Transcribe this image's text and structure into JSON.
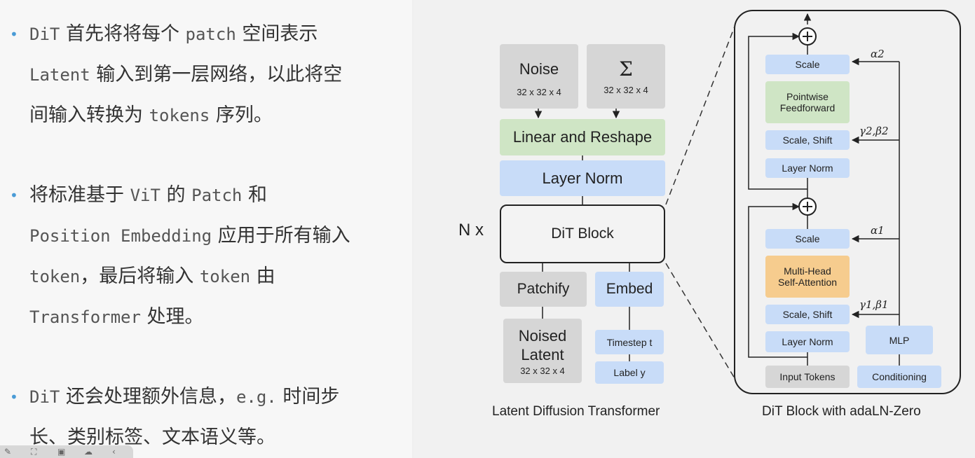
{
  "bullets": [
    {
      "lines": [
        [
          {
            "t": "DiT",
            "m": true
          },
          {
            "t": " 首先将将每个 ",
            "m": false
          },
          {
            "t": "patch",
            "m": true
          },
          {
            "t": " 空间表示",
            "m": false
          }
        ],
        [
          {
            "t": "Latent",
            "m": true
          },
          {
            "t": " 输入到第一层网络，以此将空",
            "m": false
          }
        ],
        [
          {
            "t": "间输入转换为 ",
            "m": false
          },
          {
            "t": "tokens",
            "m": true
          },
          {
            "t": " 序列。",
            "m": false
          }
        ]
      ]
    },
    {
      "lines": [
        [
          {
            "t": "将标准基于 ",
            "m": false
          },
          {
            "t": "ViT",
            "m": true
          },
          {
            "t": " 的 ",
            "m": false
          },
          {
            "t": "Patch",
            "m": true
          },
          {
            "t": " 和",
            "m": false
          }
        ],
        [
          {
            "t": "Position Embedding",
            "m": true
          },
          {
            "t": " 应用于所有输入",
            "m": false
          }
        ],
        [
          {
            "t": "token",
            "m": true
          },
          {
            "t": "，最后将输入 ",
            "m": false
          },
          {
            "t": "token",
            "m": true
          },
          {
            "t": " 由",
            "m": false
          }
        ],
        [
          {
            "t": "Transformer",
            "m": true
          },
          {
            "t": " 处理。",
            "m": false
          }
        ]
      ]
    },
    {
      "lines": [
        [
          {
            "t": "DiT",
            "m": true
          },
          {
            "t": " 还会处理额外信息，",
            "m": false
          },
          {
            "t": "e.g.",
            "m": true
          },
          {
            "t": " 时间步",
            "m": false
          }
        ],
        [
          {
            "t": "长、类别标签、文本语义等。",
            "m": false
          }
        ]
      ]
    }
  ],
  "left_diagram": {
    "noise_title": "Noise",
    "noise_dim": "32 x 32 x 4",
    "sigma_title": "Σ",
    "sigma_dim": "32 x 32 x 4",
    "linear_reshape": "Linear and Reshape",
    "layer_norm": "Layer Norm",
    "n_label": "N x",
    "dit_block": "DiT Block",
    "patchify": "Patchify",
    "embed": "Embed",
    "noised_latent_1": "Noised",
    "noised_latent_2": "Latent",
    "noised_dim": "32 x 32 x 4",
    "timestep": "Timestep t",
    "label": "Label y",
    "caption": "Latent Diffusion Transformer"
  },
  "right_diagram": {
    "scale_top": "Scale",
    "pointwise_1": "Pointwise",
    "pointwise_2": "Feedforward",
    "scale_shift_top": "Scale, Shift",
    "layer_norm_top": "Layer Norm",
    "scale_bottom": "Scale",
    "mha_1": "Multi-Head",
    "mha_2": "Self-Attention",
    "scale_shift_bottom": "Scale, Shift",
    "layer_norm_bottom": "Layer Norm",
    "mlp": "MLP",
    "input_tokens": "Input Tokens",
    "conditioning": "Conditioning",
    "alpha2": "α2",
    "gamma2beta2": "γ2,β2",
    "alpha1": "α1",
    "gamma1beta1": "γ1,β1",
    "caption": "DiT Block with adaLN-Zero"
  },
  "colors": {
    "blue": "#c8dcf8",
    "gray": "#d6d6d6",
    "green": "#cfe5c5",
    "orange": "#f6cc8e",
    "bullet": "#4a9bd6"
  },
  "toolbar_icons": [
    "pen-icon",
    "crop-icon",
    "image-icon",
    "chat-icon",
    "back-icon"
  ]
}
